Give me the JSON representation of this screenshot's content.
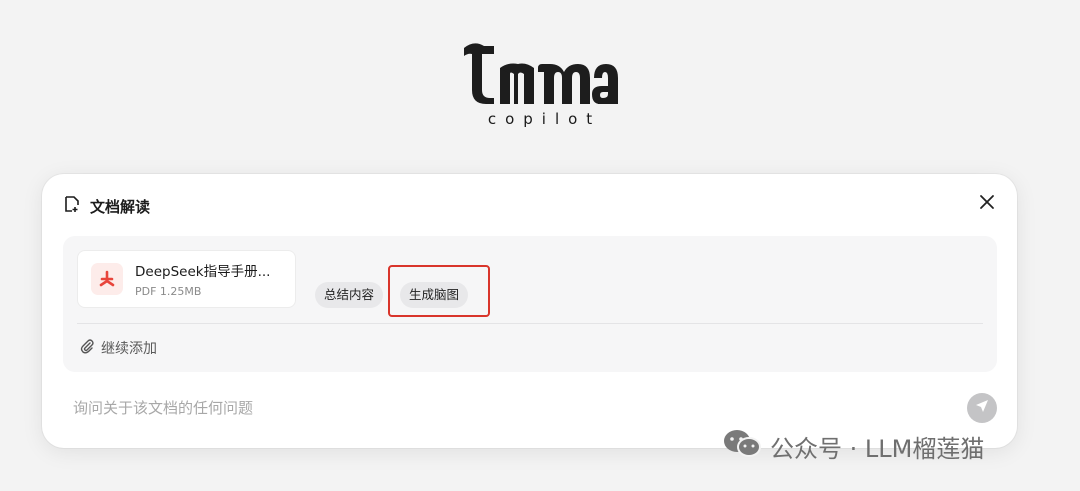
{
  "logo": {
    "subtitle": "copilot"
  },
  "card": {
    "title": "文档解读",
    "file": {
      "name": "DeepSeek指导手册...",
      "meta": "PDF 1.25MB"
    },
    "actions": {
      "summary": "总结内容",
      "mindmap": "生成脑图"
    },
    "add_more": "继续添加",
    "input_placeholder": "询问关于该文档的任何问题"
  },
  "watermark": {
    "text": "公众号 · LLM榴莲猫"
  },
  "colors": {
    "highlight": "#d9352b",
    "pdf_red": "#e8453c",
    "send_bg": "#c4c4c6"
  },
  "icons": [
    "edit-doc-icon",
    "close-icon",
    "pdf-icon",
    "paperclip-icon",
    "send-icon",
    "wechat-icon"
  ]
}
